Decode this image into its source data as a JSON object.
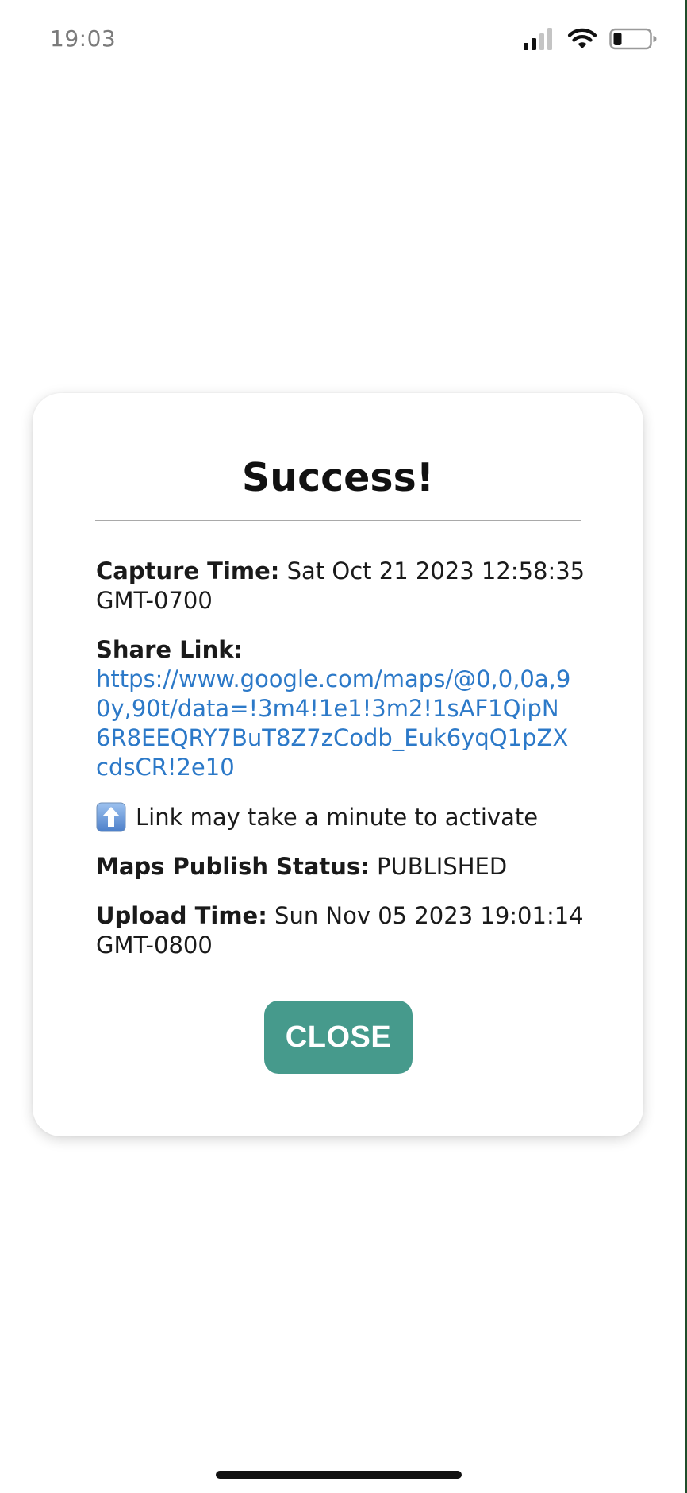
{
  "status_bar": {
    "time": "19:03",
    "icons": [
      "cellular-signal-icon",
      "wifi-icon",
      "battery-icon"
    ]
  },
  "dialog": {
    "title": "Success!",
    "capture_time": {
      "label": "Capture Time:",
      "value": " Sat Oct 21 2023 12:58:35 GMT-0700"
    },
    "share_link": {
      "label": "Share Link:",
      "url": "https://www.google.com/maps/@0,0,0a,90y,90t/data=!3m4!1e1!3m2!1sAF1QipN6R8EEQRY7BuT8Z7zCodb_Euk6yqQ1pZXcdsCR!2e10"
    },
    "notice": {
      "icon": "up-arrow-icon",
      "text": "Link may take a minute to activate"
    },
    "publish_status": {
      "label": "Maps Publish Status:",
      "value": " PUBLISHED"
    },
    "upload_time": {
      "label": "Upload Time:",
      "value": " Sun Nov 05 2023 19:01:14 GMT-0800"
    },
    "close_label": "CLOSE"
  },
  "colors": {
    "accent_button": "#469a8c",
    "link": "#2c79c8",
    "notice_icon": "#5a8ed6"
  }
}
